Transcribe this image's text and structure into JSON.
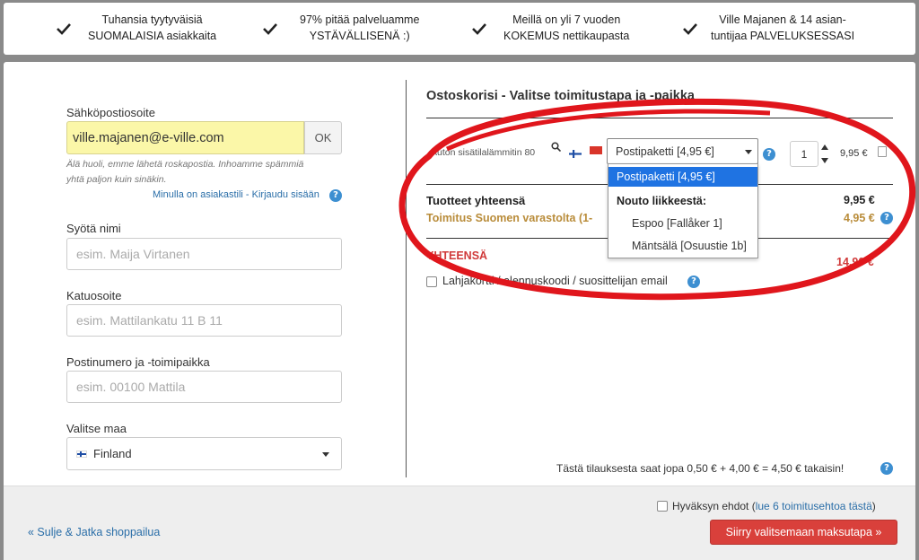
{
  "benefits": [
    {
      "line1": "Tuhansia tyytyväisiä",
      "line2": "SUOMALAISIA asiakkaita"
    },
    {
      "line1": "97% pitää palveluamme",
      "line2": "YSTÄVÄLLISENÄ :)"
    },
    {
      "line1": "Meillä on yli 7 vuoden",
      "line2": "KOKEMUS nettikaupasta"
    },
    {
      "line1": "Ville Majanen & 14 asian-",
      "line2": "tuntijaa PALVELUKSESSASI"
    }
  ],
  "form": {
    "email_label": "Sähköpostiosoite",
    "email_value": "ville.majanen@e-ville.com",
    "ok_label": "OK",
    "spam_hint_1": "Älä huoli, emme lähetä roskapostia. Inhoamme spämmiä",
    "spam_hint_2": "yhtä paljon kuin sinäkin.",
    "login_link": "Minulla on asiakastili - Kirjaudu sisään",
    "name_label": "Syötä nimi",
    "name_placeholder": "esim. Maija Virtanen",
    "street_label": "Katuosoite",
    "street_placeholder": "esim. Mattilankatu 11 B 11",
    "postal_label": "Postinumero ja -toimipaikka",
    "postal_placeholder": "esim. 00100 Mattila",
    "country_label": "Valitse maa",
    "country_value": "Finland"
  },
  "cart": {
    "title": "Ostoskorisi - Valitse toimitustapa ja -paikka",
    "product_name": "Auton sisätilalämmitin 80",
    "shipping_select": "Postipaketti [4,95 €]",
    "quantity": "1",
    "item_price": "9,95 €",
    "dropdown": {
      "selected": "Postipaketti [4,95 €]",
      "group": "Nouto liikkeestä:",
      "options": [
        "Espoo [Fallåker 1]",
        "Mäntsälä [Osuustie 1b]"
      ]
    },
    "products_total_label": "Tuotteet yhteensä",
    "products_total_value": "9,95 €",
    "shipping_label": "Toimitus Suomen varastolta (1-",
    "shipping_value": "4,95 €",
    "grand_total_label": "YHTEENSÄ",
    "grand_total_value": "14,90 €",
    "gift_label": "Lahjakortti / alennuskoodi / suosittelijan email",
    "cashback_text": "Tästä tilauksesta saat jopa 0,50 € + 4,00 € = 4,50 € takaisin!"
  },
  "footer": {
    "terms_prefix": "Hyväksyn ehdot (",
    "terms_link": "lue 6 toimitusehtoa tästä",
    "terms_suffix": ")",
    "back_link": "« Sulje & Jatka shoppailua",
    "proceed_button": "Siirry valitsemaan maksutapa »"
  },
  "colors": {
    "highlight_ellipse": "#e0161c",
    "accent_red": "#d9403b",
    "link_blue": "#2a6ea8",
    "dropdown_selected": "#1f73e2",
    "email_fill": "#fbf7a8"
  }
}
